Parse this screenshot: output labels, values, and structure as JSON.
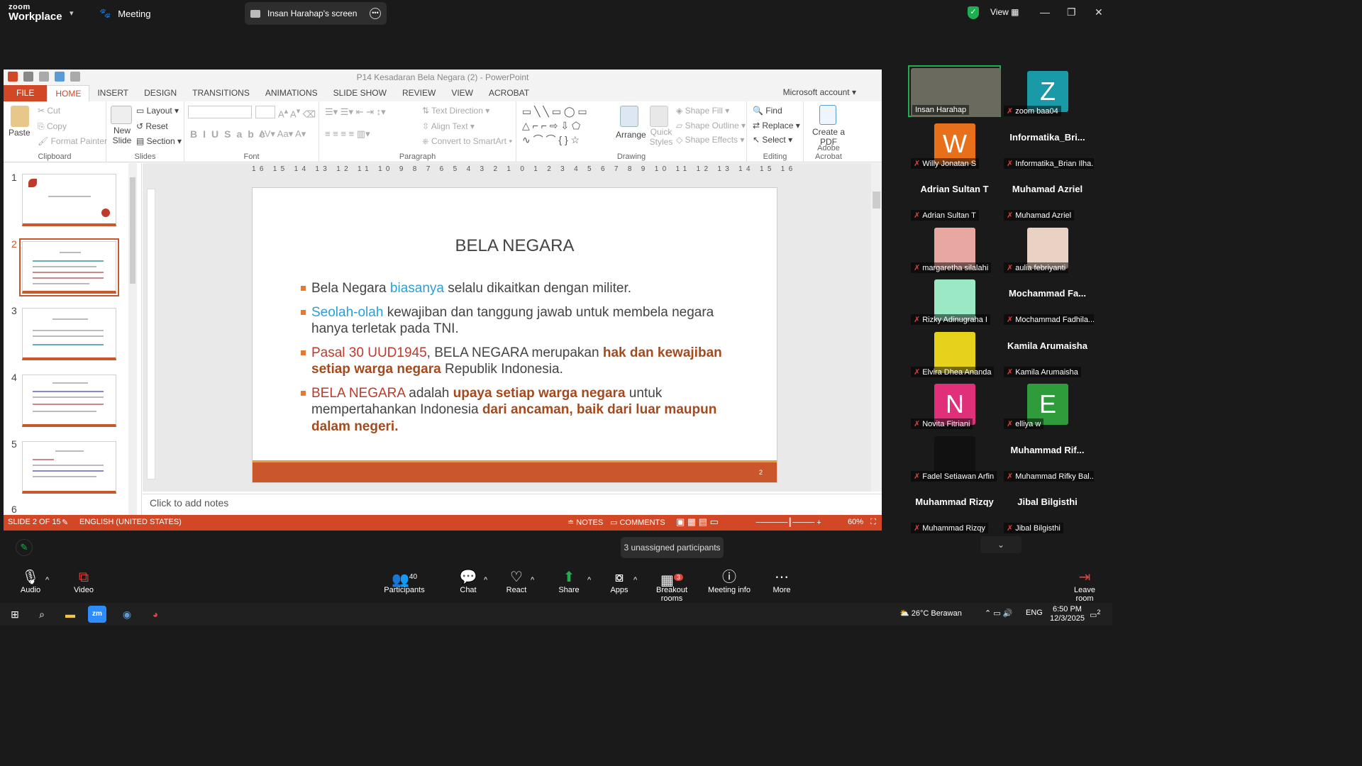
{
  "zoom": {
    "logo_line1": "zoom",
    "logo_line2": "Workplace",
    "meeting_label": "Meeting",
    "screen_tab": "Insan Harahap's screen",
    "view_label": "View",
    "tooltip": "3 unassigned participants",
    "toolbar": [
      {
        "label": "Audio",
        "icon": "mic-muted-icon"
      },
      {
        "label": "Video",
        "icon": "video-off-icon"
      },
      {
        "label": "Participants",
        "icon": "participants-icon",
        "count": "40"
      },
      {
        "label": "Chat",
        "icon": "chat-icon"
      },
      {
        "label": "React",
        "icon": "react-icon"
      },
      {
        "label": "Share",
        "icon": "share-icon"
      },
      {
        "label": "Apps",
        "icon": "apps-icon"
      },
      {
        "label": "Breakout rooms",
        "icon": "breakout-icon",
        "badge": "3"
      },
      {
        "label": "Meeting info",
        "icon": "info-icon"
      },
      {
        "label": "More",
        "icon": "more-icon"
      },
      {
        "label": "Leave room",
        "icon": "leave-icon"
      }
    ],
    "participants": [
      {
        "name": "Insan Harahap",
        "type": "video",
        "active": true
      },
      {
        "name": "zoom baa04",
        "type": "letter",
        "letter": "Z",
        "color": "#1a9aa6"
      },
      {
        "name": "Willy Jonatan S",
        "type": "letter",
        "letter": "W",
        "color": "#e8701a"
      },
      {
        "name": "Informatika_Brian Ilha...",
        "type": "name",
        "big": "Informatika_Bri..."
      },
      {
        "name": "Adrian Sultan T",
        "type": "name",
        "big": "Adrian Sultan T"
      },
      {
        "name": "Muhamad Azriel",
        "type": "name",
        "big": "Muhamad Azriel"
      },
      {
        "name": "margaretha silalahi",
        "type": "photo",
        "color": "#e8a7a0"
      },
      {
        "name": "aulia febriyanti",
        "type": "photo",
        "color": "#e9d2c3"
      },
      {
        "name": "Rizky Adinugraha I",
        "type": "photo",
        "color": "#9be8c5"
      },
      {
        "name": "Mochammad Fadhila...",
        "type": "name",
        "big": "Mochammad Fa..."
      },
      {
        "name": "Elvira Dhea Ananda",
        "type": "photo",
        "color": "#e6d21a"
      },
      {
        "name": "Kamila Arumaisha",
        "type": "name",
        "big": "Kamila Arumaisha"
      },
      {
        "name": "Novita Fitriani",
        "type": "letter",
        "letter": "N",
        "color": "#e0307a"
      },
      {
        "name": "elliya w",
        "type": "letter",
        "letter": "E",
        "color": "#2e9c3a"
      },
      {
        "name": "Fadel Setiawan Arfin",
        "type": "photo",
        "color": "#111111"
      },
      {
        "name": "Muhammad Rifky Bal...",
        "type": "name",
        "big": "Muhammad  Rif..."
      },
      {
        "name": "Muhammad Rizqy",
        "type": "name",
        "big": "Muhammad Rizqy"
      },
      {
        "name": "Jibal Bilgisthi",
        "type": "name",
        "big": "Jibal Bilgisthi"
      }
    ]
  },
  "ppt": {
    "window_title": "P14 Kesadaran Bela Negara (2) - PowerPoint",
    "account": "Microsoft account",
    "tabs": [
      "FILE",
      "HOME",
      "INSERT",
      "DESIGN",
      "TRANSITIONS",
      "ANIMATIONS",
      "SLIDE SHOW",
      "REVIEW",
      "VIEW",
      "ACROBAT"
    ],
    "ribbon": {
      "clipboard": {
        "paste": "Paste",
        "cut": "Cut",
        "copy": "Copy",
        "format_painter": "Format Painter",
        "label": "Clipboard"
      },
      "slides": {
        "new_slide": "New Slide",
        "layout": "Layout",
        "reset": "Reset",
        "section": "Section",
        "label": "Slides"
      },
      "font": {
        "label": "Font"
      },
      "paragraph": {
        "text_direction": "Text Direction",
        "align_text": "Align Text",
        "smartart": "Convert to SmartArt",
        "label": "Paragraph"
      },
      "drawing": {
        "arrange": "Arrange",
        "quick_styles": "Quick Styles",
        "shape_fill": "Shape Fill",
        "shape_outline": "Shape Outline",
        "shape_effects": "Shape Effects",
        "label": "Drawing"
      },
      "editing": {
        "find": "Find",
        "replace": "Replace",
        "select": "Select",
        "label": "Editing"
      },
      "acrobat": {
        "create_pdf": "Create a PDF",
        "label": "Adobe Acrobat"
      }
    },
    "ruler_text": "16 15 14 13 12 11 10 9 8 7 6 5 4 3 2 1 0 1 2 3 4 5 6 7 8 9 10 11 12 13 14 15 16",
    "thumbnails": [
      "1",
      "2",
      "3",
      "4",
      "5",
      "6"
    ],
    "slide": {
      "title": "BELA NEGARA",
      "b1_a": "Bela Negara ",
      "b1_b": "biasanya",
      "b1_c": " selalu dikaitkan dengan militer.",
      "b2_a": "Seolah-olah",
      "b2_b": " kewajiban dan tanggung jawab untuk membela negara hanya terletak pada TNI.",
      "b3_a": "Pasal 30 UUD1945",
      "b3_b": ", BELA NEGARA merupakan ",
      "b3_c": "hak dan kewajiban setiap warga negara",
      "b3_d": " Republik Indonesia.",
      "b4_a": "BELA NEGARA",
      "b4_b": " adalah ",
      "b4_c": "upaya setiap warga negara",
      "b4_d": " untuk mempertahankan Indonesia ",
      "b4_e": "dari ancaman, baik dari luar maupun dalam negeri.",
      "page": "2"
    },
    "notes_placeholder": "Click to add notes",
    "status": {
      "slide": "SLIDE 2 OF 15",
      "lang": "ENGLISH (UNITED STATES)",
      "notes": "NOTES",
      "comments": "COMMENTS",
      "zoom": "60%"
    }
  },
  "taskbar": {
    "weather": "26°C  Berawan",
    "lang": "ENG",
    "time": "6:50 PM",
    "date": "12/3/2025",
    "notif": "2"
  }
}
